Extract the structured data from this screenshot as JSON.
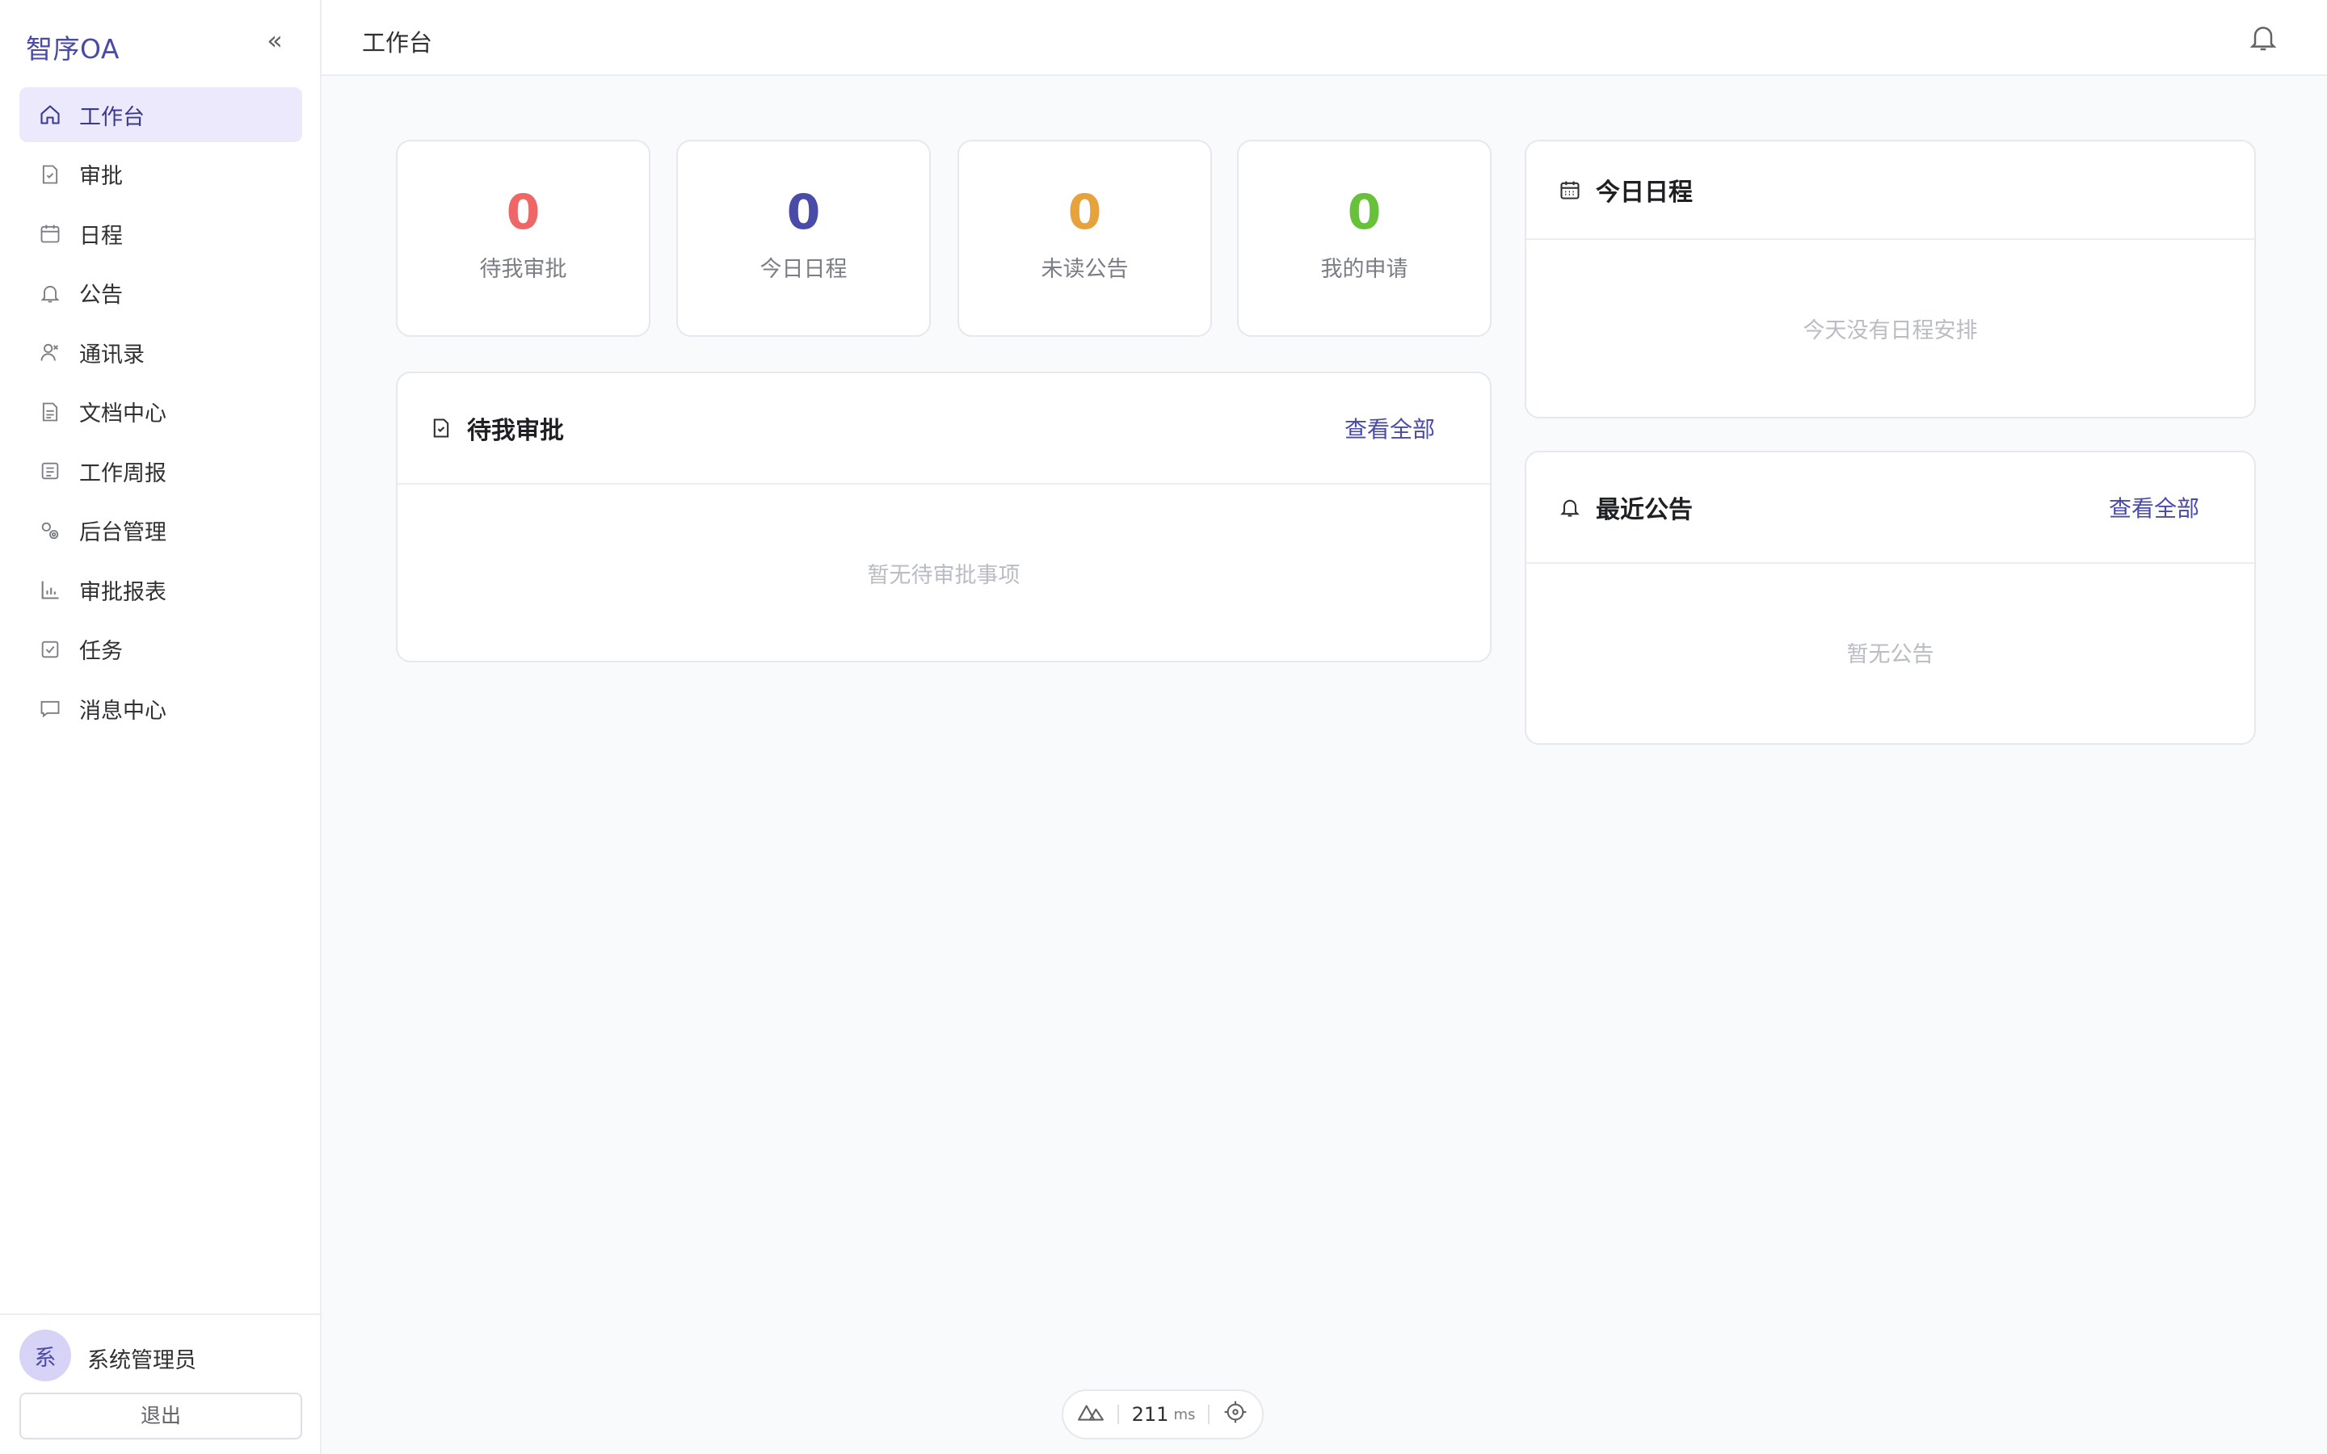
{
  "app": {
    "brand": "智序OA",
    "collapse_glyph": "«"
  },
  "sidebar": {
    "items": [
      {
        "label": "工作台",
        "icon": "home-icon",
        "active": true
      },
      {
        "label": "审批",
        "icon": "approval-doc-icon"
      },
      {
        "label": "日程",
        "icon": "calendar-icon"
      },
      {
        "label": "公告",
        "icon": "bell-icon"
      },
      {
        "label": "通讯录",
        "icon": "contacts-icon"
      },
      {
        "label": "文档中心",
        "icon": "document-icon"
      },
      {
        "label": "工作周报",
        "icon": "report-list-icon"
      },
      {
        "label": "后台管理",
        "icon": "admin-settings-icon"
      },
      {
        "label": "审批报表",
        "icon": "bar-chart-icon"
      },
      {
        "label": "任务",
        "icon": "task-check-icon"
      },
      {
        "label": "消息中心",
        "icon": "message-icon"
      }
    ],
    "user": {
      "avatar_text": "系",
      "name": "系统管理员"
    },
    "logout_label": "退出"
  },
  "header": {
    "title": "工作台",
    "notification_icon": "bell-icon"
  },
  "stats": [
    {
      "value": "0",
      "label": "待我审批",
      "color": "#ee6666"
    },
    {
      "value": "0",
      "label": "今日日程",
      "color": "#4a4aa8"
    },
    {
      "value": "0",
      "label": "未读公告",
      "color": "#e6a23c"
    },
    {
      "value": "0",
      "label": "我的申请",
      "color": "#67c23a"
    }
  ],
  "pending_panel": {
    "title": "待我审批",
    "link": "查看全部",
    "empty": "暂无待审批事项"
  },
  "schedule_panel": {
    "title": "今日日程",
    "empty": "今天没有日程安排"
  },
  "notice_panel": {
    "title": "最近公告",
    "link": "查看全部",
    "empty": "暂无公告"
  },
  "devbar": {
    "time": "211",
    "unit": "ms"
  },
  "colors": {
    "accent": "#4a4aa8",
    "active_bg": "#ebe9fb"
  }
}
